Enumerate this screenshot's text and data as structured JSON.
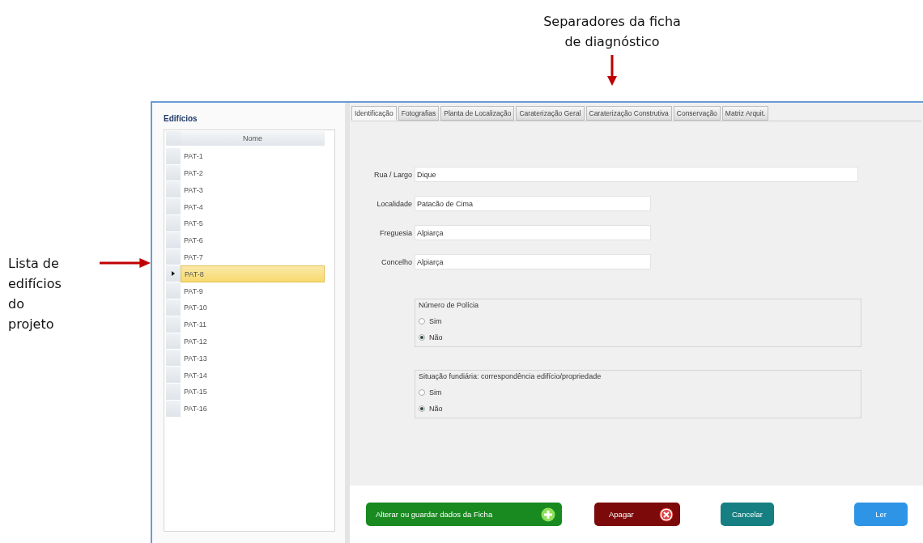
{
  "annotations": [
    {
      "kind": "top",
      "text": "Separadores da ficha\nde diagnóstico"
    },
    {
      "kind": "left",
      "text": "Lista de\nedifícios\ndo\nprojeto"
    }
  ],
  "buildings": {
    "title": "Edifícios",
    "column": "Nome",
    "rows": [
      {
        "name": "PAT-1",
        "selected": false
      },
      {
        "name": "PAT-2",
        "selected": false
      },
      {
        "name": "PAT-3",
        "selected": false
      },
      {
        "name": "PAT-4",
        "selected": false
      },
      {
        "name": "PAT-5",
        "selected": false
      },
      {
        "name": "PAT-6",
        "selected": false
      },
      {
        "name": "PAT-7",
        "selected": false
      },
      {
        "name": "PAT-8",
        "selected": true
      },
      {
        "name": "PAT-9",
        "selected": false
      },
      {
        "name": "PAT-10",
        "selected": false
      },
      {
        "name": "PAT-11",
        "selected": false
      },
      {
        "name": "PAT-12",
        "selected": false
      },
      {
        "name": "PAT-13",
        "selected": false
      },
      {
        "name": "PAT-14",
        "selected": false
      },
      {
        "name": "PAT-15",
        "selected": false
      },
      {
        "name": "PAT-16",
        "selected": false
      }
    ]
  },
  "tabs": [
    {
      "label": "Identificação",
      "selected": true
    },
    {
      "label": "Fotografias",
      "selected": false
    },
    {
      "label": "Planta de Localização",
      "selected": false
    },
    {
      "label": "Caraterização Geral",
      "selected": false
    },
    {
      "label": "Caraterização Construtiva",
      "selected": false
    },
    {
      "label": "Conservação",
      "selected": false
    },
    {
      "label": "Matriz Arquit.",
      "selected": false
    }
  ],
  "fields": [
    {
      "label": "Rua / Largo",
      "value": "Dique",
      "kind": "wide"
    },
    {
      "label": "Localidade",
      "value": "Patacão de Cima",
      "kind": "narrow"
    },
    {
      "label": "Freguesia",
      "value": "Alpiarça",
      "kind": "narrow"
    },
    {
      "label": "Concelho",
      "value": "Alpiarça",
      "kind": "narrow"
    }
  ],
  "groups": [
    {
      "legend": "Número de Polícia",
      "options": [
        {
          "label": "Sim",
          "selected": false
        },
        {
          "label": "Não",
          "selected": true
        }
      ]
    },
    {
      "legend": "Situação fundiária: correspondência edifício/propriedade",
      "options": [
        {
          "label": "Sim",
          "selected": false
        },
        {
          "label": "Não",
          "selected": true
        }
      ]
    }
  ],
  "buttons": [
    {
      "label": "Alterar ou guardar dados da Ficha",
      "kind": "save"
    },
    {
      "label": "Apagar",
      "kind": "delete"
    },
    {
      "label": "Cancelar",
      "kind": "cancel"
    },
    {
      "label": "Ler",
      "kind": "read"
    }
  ]
}
